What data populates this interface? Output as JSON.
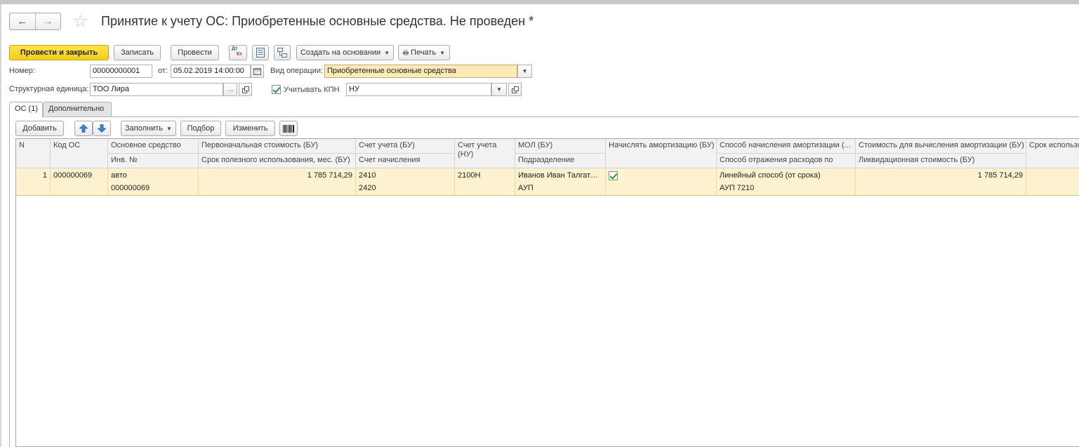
{
  "window": {
    "title": "Принятие к учету ОС: Приобретенные основные средства. Не проведен *"
  },
  "nav": {
    "back_icon": "←",
    "forward_icon": "→",
    "favorite_icon": "☆"
  },
  "toolbar": {
    "post_close_label": "Провести и закрыть",
    "save_label": "Записать",
    "post_label": "Провести",
    "dtkt_icon_dt": "Дт",
    "dtkt_icon_kt": "Кт",
    "create_based_label": "Создать на основании",
    "print_label": "Печать"
  },
  "form": {
    "number_label": "Номер:",
    "number_value": "00000000001",
    "date_label": "от:",
    "date_value": "05.02.2019 14:00:00",
    "operation_label": "Вид операции:",
    "operation_value": "Приобретенные основные средства",
    "unit_label": "Структурная единица:",
    "unit_value": "ТОО  Лира",
    "unit_select": "...",
    "kpn_label": "Учитывать КПН",
    "kpn_value": "НУ"
  },
  "tabs": [
    {
      "label": "ОС (1)",
      "active": true
    },
    {
      "label": "Дополнительно",
      "active": false
    }
  ],
  "table_toolbar": {
    "add_label": "Добавить",
    "fill_label": "Заполнить",
    "pick_label": "Подбор",
    "edit_label": "Изменить"
  },
  "table": {
    "headers": {
      "n": "N",
      "code": "Код ОС",
      "asset_1": "Основное средство",
      "asset_2": "Инв. №",
      "cost_1": "Первоначальная стоимость (БУ)",
      "cost_2": "Срок полезного использования, мес. (БУ)",
      "acc_1": "Счет учета (БУ)",
      "acc_2": "Счет начисления",
      "accnu_1": "Счет учета",
      "accnu_2": "(НУ)",
      "mol_1": "МОЛ (БУ)",
      "mol_2": "Подразделение",
      "amort": "Начислять амортизацию (БУ)",
      "method_1": "Способ начисления амортизации (...",
      "method_2": "Способ отражения расходов по",
      "basecost_1": "Стоимость для вычисления амортизации (БУ)",
      "basecost_2": "Ликвидационная стоимость (БУ)",
      "term": "Срок использо"
    },
    "rows": [
      {
        "n": "1",
        "code": "000000069",
        "asset": "авто",
        "inv": "000000069",
        "cost": "1 785 714,29",
        "life": "",
        "acc": "2410",
        "acc2": "2420",
        "accnu": "2100Н",
        "mol": "Иванов Иван Талгатович",
        "dept": "АУП",
        "amort": true,
        "method": "Линейный способ (от срока)",
        "expense": "АУП 7210",
        "basecost": "1 785 714,29",
        "liq": ""
      }
    ]
  }
}
